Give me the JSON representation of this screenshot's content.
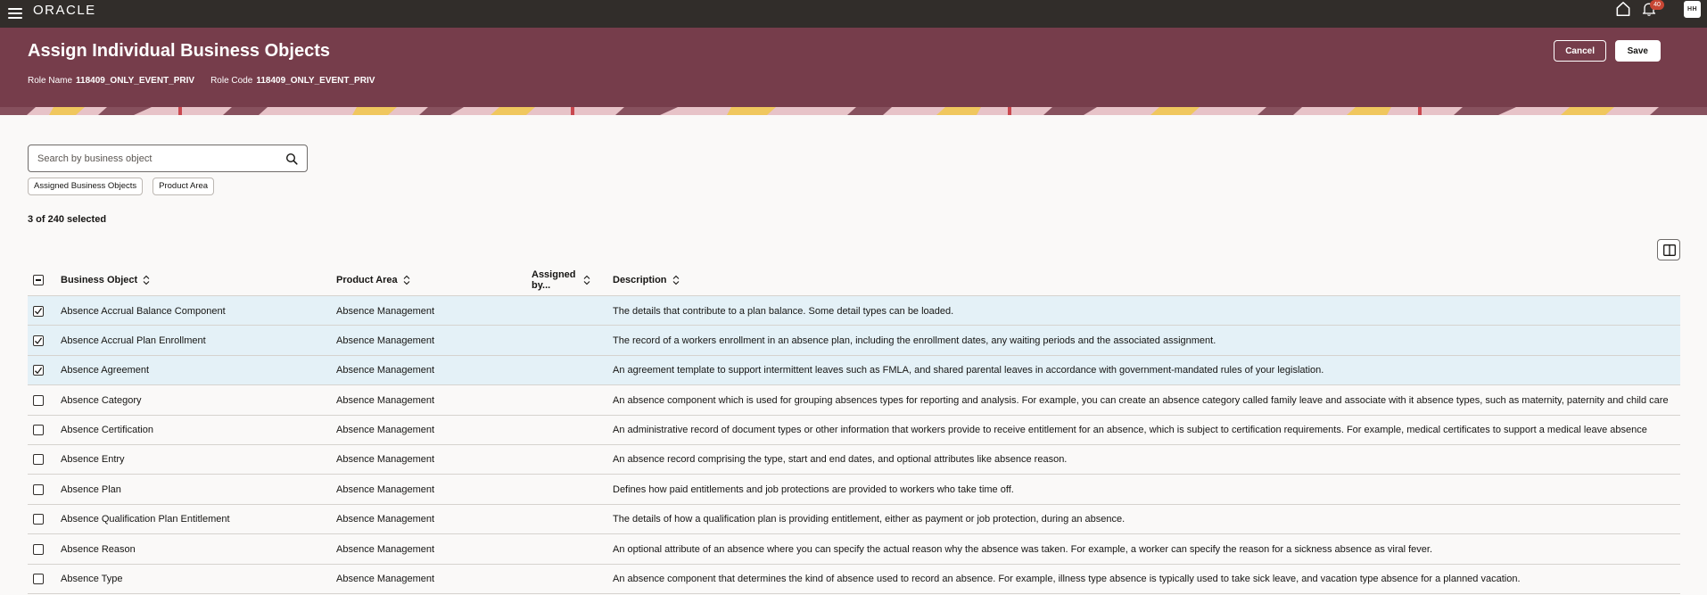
{
  "app": {
    "brand": "ORACLE",
    "notification_count": "40",
    "avatar_initials": "HH"
  },
  "header": {
    "title": "Assign Individual Business Objects",
    "role_name_label": "Role Name",
    "role_name_value": "118409_ONLY_EVENT_PRIV",
    "role_code_label": "Role Code",
    "role_code_value": "118409_ONLY_EVENT_PRIV",
    "cancel_label": "Cancel",
    "save_label": "Save"
  },
  "search": {
    "placeholder": "Search by business object",
    "value": ""
  },
  "filters": [
    "Assigned Business Objects",
    "Product Area"
  ],
  "selection": {
    "text": "3 of 240 selected"
  },
  "table": {
    "columns": {
      "business_object": "Business Object",
      "product_area": "Product Area",
      "assigned_by": "Assigned by...",
      "description": "Description"
    },
    "rows": [
      {
        "checked": true,
        "business_object": "Absence Accrual Balance Component",
        "product_area": "Absence Management",
        "assigned_by": "",
        "description": "The details that contribute to a plan balance. Some detail types can be loaded."
      },
      {
        "checked": true,
        "business_object": "Absence Accrual Plan Enrollment",
        "product_area": "Absence Management",
        "assigned_by": "",
        "description": "The record of a workers enrollment in an absence plan, including the enrollment dates, any waiting periods and the associated assignment."
      },
      {
        "checked": true,
        "business_object": "Absence Agreement",
        "product_area": "Absence Management",
        "assigned_by": "",
        "description": "An agreement template to support intermittent leaves such as FMLA, and shared parental leaves in accordance with government-mandated rules of your legislation."
      },
      {
        "checked": false,
        "business_object": "Absence Category",
        "product_area": "Absence Management",
        "assigned_by": "",
        "description": "An absence component which is used for grouping absences types for reporting and analysis. For example, you can create an absence category called family leave and associate with it absence types, such as maternity, paternity and child care"
      },
      {
        "checked": false,
        "business_object": "Absence Certification",
        "product_area": "Absence Management",
        "assigned_by": "",
        "description": "An administrative record of document types or other information that workers provide to receive entitlement for an absence, which is subject to certification requirements. For example, medical certificates to support a medical leave absence"
      },
      {
        "checked": false,
        "business_object": "Absence Entry",
        "product_area": "Absence Management",
        "assigned_by": "",
        "description": "An absence record comprising the type, start and end dates, and optional attributes like absence reason."
      },
      {
        "checked": false,
        "business_object": "Absence Plan",
        "product_area": "Absence Management",
        "assigned_by": "",
        "description": "Defines how paid entitlements and job protections are provided to workers who take time off."
      },
      {
        "checked": false,
        "business_object": "Absence Qualification Plan Entitlement",
        "product_area": "Absence Management",
        "assigned_by": "",
        "description": "The details of how a qualification plan is providing entitlement, either as payment or job protection, during an absence."
      },
      {
        "checked": false,
        "business_object": "Absence Reason",
        "product_area": "Absence Management",
        "assigned_by": "",
        "description": "An optional attribute of an absence where you can specify the actual reason why the absence was taken. For example, a worker can specify the reason for a sickness absence as viral fever."
      },
      {
        "checked": false,
        "business_object": "Absence Type",
        "product_area": "Absence Management",
        "assigned_by": "",
        "description": "An absence component that determines the kind of absence used to record an absence. For example, illness type absence is typically used to take sick leave, and vacation type absence for a planned vacation."
      }
    ]
  },
  "colors": {
    "topbar": "#312d2a",
    "header": "#763d4b",
    "selected_row": "#e4f1f7",
    "badge": "#c74634"
  },
  "icons": [
    "hamburger-icon",
    "home-icon",
    "bell-icon",
    "search-icon",
    "sort-icon",
    "column-toggle-icon"
  ]
}
